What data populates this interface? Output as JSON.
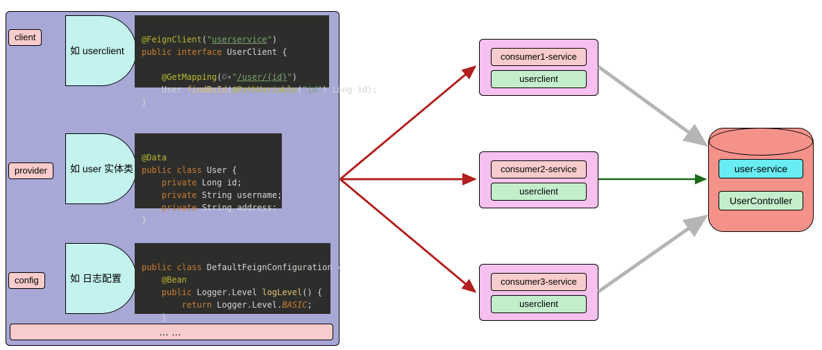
{
  "tags": {
    "client": "client",
    "provider": "provider",
    "config": "config"
  },
  "dshape": {
    "client": "如 userclient",
    "provider": "如 user 实体类",
    "config": "如 日志配置"
  },
  "code": {
    "feign": "@FeignClient(\"userservice\")\npublic interface UserClient {\n\n    @GetMapping(\"/user/{id}\")\n    User findById(@PathVariable(\"id\") Long id);\n}",
    "entity": "@Data\npublic class User {\n    private Long id;\n    private String username;\n    private String address;\n}",
    "config": "public class DefaultFeignConfiguration {\n    @Bean\n    public Logger.Level logLevel() {\n        return Logger.Level.BASIC;\n    }\n}"
  },
  "dots": "……",
  "consumers": [
    {
      "svc": "consumer1-service",
      "dep": "userclient"
    },
    {
      "svc": "consumer2-service",
      "dep": "userclient"
    },
    {
      "svc": "consumer3-service",
      "dep": "userclient"
    }
  ],
  "db": {
    "title": "user-service",
    "ctrl": "UserController"
  }
}
